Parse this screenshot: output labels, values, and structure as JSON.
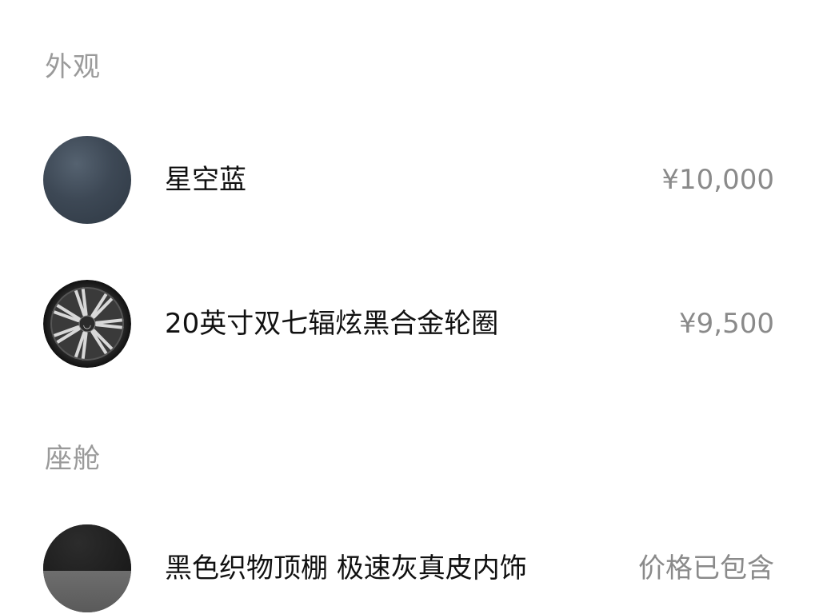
{
  "sections": [
    {
      "title": "外观",
      "items": [
        {
          "name": "星空蓝",
          "price": "¥10,000",
          "icon": "paint-color-swatch"
        },
        {
          "name": "20英寸双七辐炫黑合金轮圈",
          "price": "¥9,500",
          "icon": "wheel-rim-icon"
        }
      ]
    },
    {
      "title": "座舱",
      "items": [
        {
          "name": "黑色织物顶棚 极速灰真皮内饰",
          "price": "价格已包含",
          "icon": "interior-swatch"
        }
      ]
    }
  ],
  "colors": {
    "section_title": "#9a9a9a",
    "item_name": "#111111",
    "item_price": "#8a8a8a",
    "paint": "#3d4855"
  }
}
